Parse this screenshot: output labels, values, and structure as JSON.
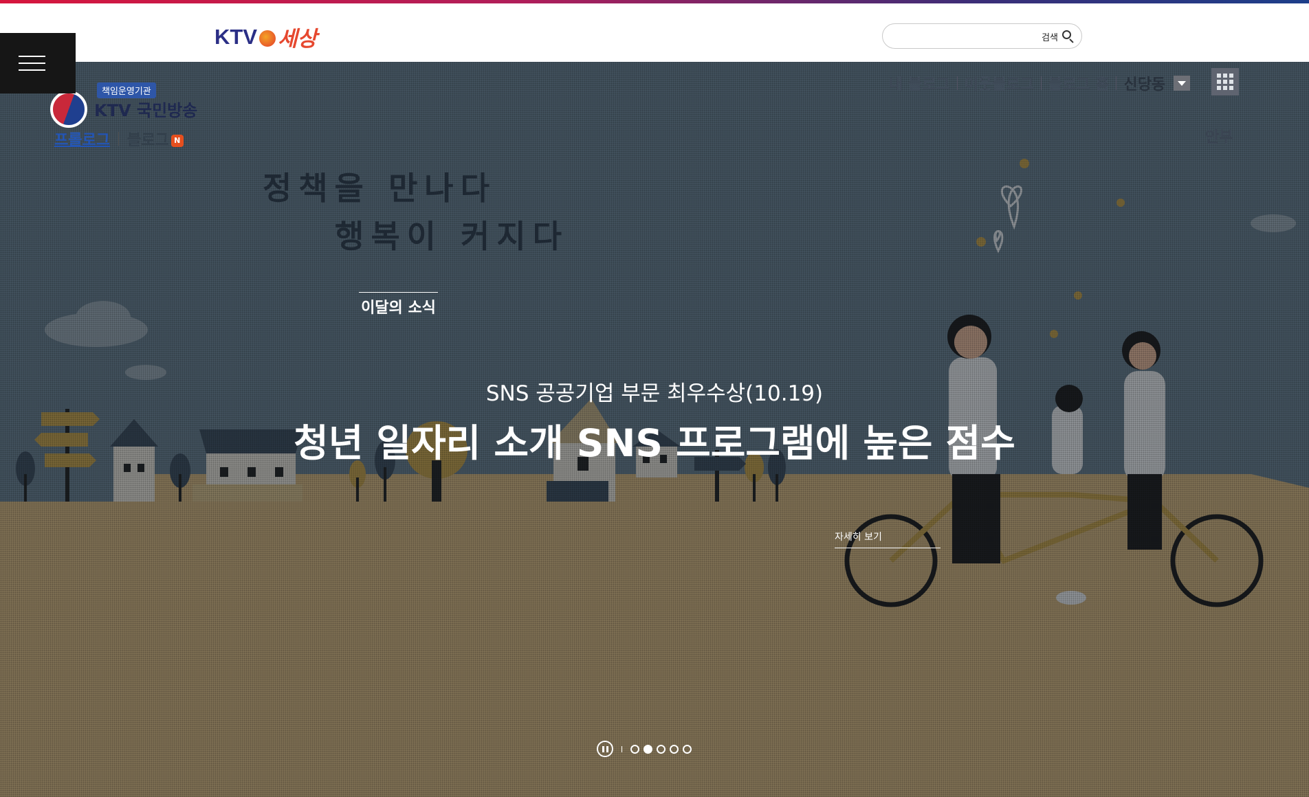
{
  "header": {
    "logo_ktv": "KTV",
    "logo_sesang": "세상",
    "search_placeholder": "",
    "search_label": "검색"
  },
  "blog": {
    "badge": "책임운영기관",
    "name": "KTV 국민방송",
    "tab_prolog": "프롤로그",
    "tab_blog": "블로그",
    "new_badge": "N"
  },
  "util_nav": {
    "my_blog": "내 블로그",
    "neighbor_blog": "이웃블로그",
    "blog_home": "블로그 홈",
    "sindangdong": "신당동",
    "guide": "안부"
  },
  "hero": {
    "slogan_line1": "정책을 만나다",
    "slogan_line2": "행복이 커지다",
    "section_label": "이달의 소식",
    "slide_subtitle": "SNS 공공기업 부문 최우수상(10.19)",
    "slide_title": "청년 일자리 소개 SNS 프로그램에 높은 점수",
    "more_link": "자세히 보기"
  },
  "pager": {
    "total_dots": 5,
    "active_index": 1
  },
  "colors": {
    "accent_red": "#d6163d",
    "accent_blue": "#1d3f8a",
    "sky": "#6a8090",
    "ground": "#d4b67e"
  }
}
